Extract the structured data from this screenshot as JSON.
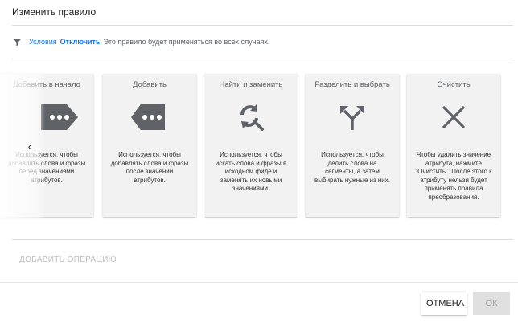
{
  "dialog": {
    "title": "Изменить правило"
  },
  "conditions": {
    "label": "Условия",
    "disable_link": "Отключить",
    "description": "Это правило будет применяться во всех случаях."
  },
  "operations": [
    {
      "title": "Добавить в начало",
      "icon": "tag-dots-left-icon",
      "description": "Используется, чтобы добавлять слова и фразы перед значениями атрибутов."
    },
    {
      "title": "Добавить",
      "icon": "tag-dots-right-icon",
      "description": "Используется, чтобы добавлять слова и фразы после значений атрибутов."
    },
    {
      "title": "Найти и заменить",
      "icon": "find-replace-icon",
      "description": "Используется, чтобы искать слова и фразы в исходном фиде и заменять их новыми значениями."
    },
    {
      "title": "Разделить и выбрать",
      "icon": "split-arrows-icon",
      "description": "Используется, чтобы делить слова на сегменты, а затем выбирать нужные из них."
    },
    {
      "title": "Очистить",
      "icon": "close-x-icon",
      "description": "Чтобы удалить значение атрибута, нажмите \"Очистить\". После этого к атрибуту нельзя будет применять правила преобразования."
    }
  ],
  "carousel": {
    "prev_icon": "chevron-left-icon"
  },
  "footer": {
    "add_operation": "ДОБАВИТЬ ОПЕРАЦИЮ",
    "cancel": "ОТМЕНА",
    "ok": "ОК"
  },
  "colors": {
    "link": "#1a73e8",
    "icon_dark": "#5f6368",
    "card_bg": "#f2f2f2"
  }
}
